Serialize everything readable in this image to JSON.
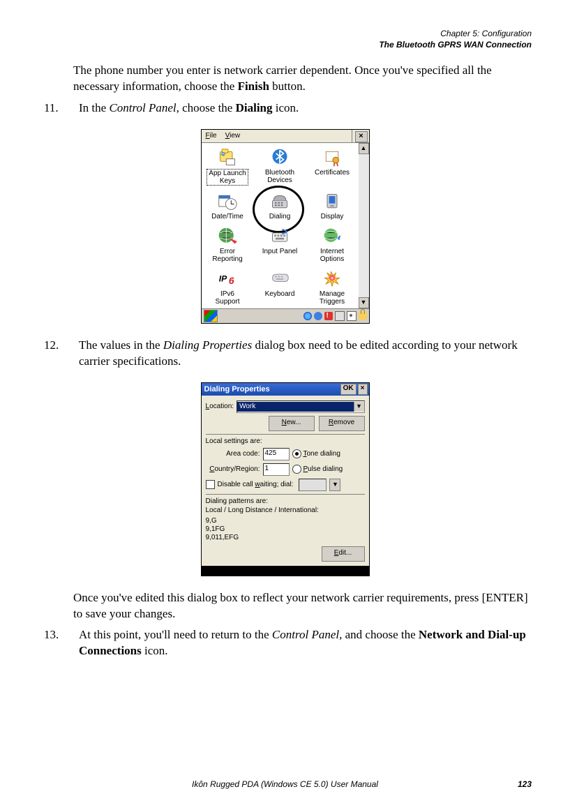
{
  "header": {
    "chapter": "Chapter 5:  Configuration",
    "section": "The Bluetooth GPRS WAN Connection"
  },
  "intro_para": "The phone number you enter is network carrier dependent. Once you've specified all the necessary information, choose the Finish button.",
  "intro_bold": "Finish",
  "steps": {
    "s11": {
      "num": "11.",
      "text_a": "In the ",
      "italic_a": "Control Panel",
      "text_b": ", choose the ",
      "bold_a": "Dialing",
      "text_c": " icon."
    },
    "s12": {
      "num": "12.",
      "text_a": "The values in the ",
      "italic_a": "Dialing Properties",
      "text_b": " dialog box need to be edited according to your network carrier specifications.",
      "after_a": "Once you've edited this dialog box to reflect your network carrier requirements, press [ENTER] to save your changes."
    },
    "s13": {
      "num": "13.",
      "text_a": "At this point, you'll need to return to the ",
      "italic_a": "Control Panel,",
      "text_b": " and choose the ",
      "bold_a": "Network and Dial-up Connections",
      "text_c": " icon."
    }
  },
  "control_panel": {
    "menu_file_u": "F",
    "menu_file_rest": "ile",
    "menu_view_u": "V",
    "menu_view_rest": "iew",
    "close": "×",
    "scroll_up": "▲",
    "scroll_down": "▼",
    "items": [
      "App Launch\nKeys",
      "Bluetooth\nDevices",
      "Certificates",
      "Date/Time",
      "Dialing",
      "Display",
      "Error\nReporting",
      "Input Panel",
      "Internet\nOptions",
      "IPv6\nSupport",
      "Keyboard",
      "Manage\nTriggers"
    ]
  },
  "dialing": {
    "title": "Dialing Properties",
    "ok": "OK",
    "close": "×",
    "location_lbl_u": "L",
    "location_lbl_rest": "ocation:",
    "location_val": "Work",
    "new_btn_u": "N",
    "new_btn_rest": "ew...",
    "remove_btn_u": "R",
    "remove_btn_rest": "emove",
    "local_heading": "Local settings are:",
    "area_lbl": "Area code:",
    "area_val": "425",
    "tone_u": "T",
    "tone_rest": "one dialing",
    "country_lbl_u": "C",
    "country_lbl_rest": "ountry/Region:",
    "country_val": "1",
    "pulse_u": "P",
    "pulse_rest": "ulse dialing",
    "disable_a": "Disable call ",
    "disable_u": "w",
    "disable_b": "aiting; dial:",
    "patterns_heading": "Dialing patterns are:",
    "patterns_sub": "Local / Long Distance / International:",
    "patterns_lines": "9,G\n9,1FG\n9,011,EFG",
    "edit_btn_u": "E",
    "edit_btn_rest": "dit..."
  },
  "footer": {
    "book": "Ikôn Rugged PDA (Windows CE 5.0) User Manual",
    "pagenum": "123"
  }
}
